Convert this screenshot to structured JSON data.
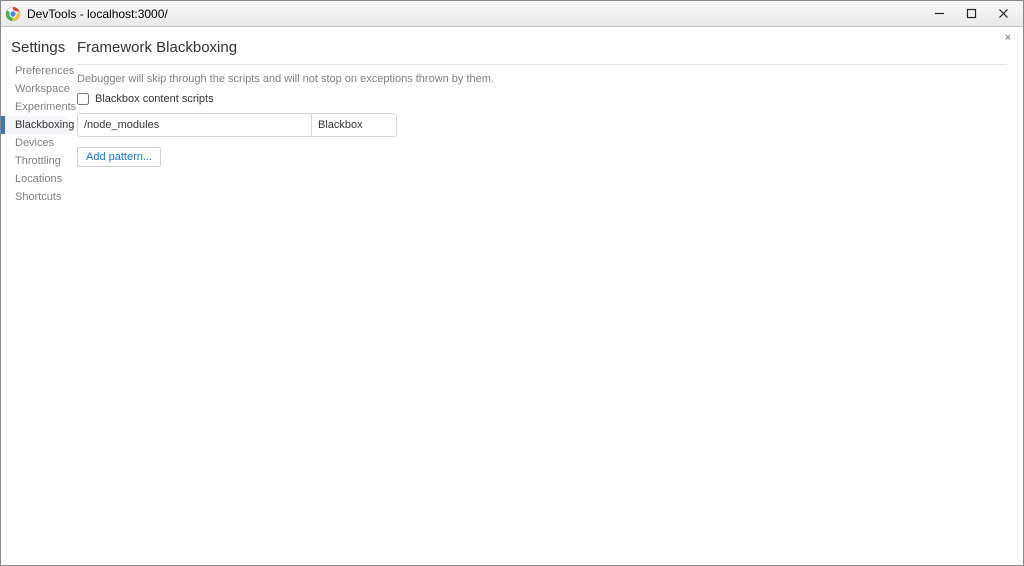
{
  "window": {
    "title": "DevTools - localhost:3000/"
  },
  "sidebar": {
    "title": "Settings",
    "items": [
      {
        "label": "Preferences"
      },
      {
        "label": "Workspace"
      },
      {
        "label": "Experiments"
      },
      {
        "label": "Blackboxing"
      },
      {
        "label": "Devices"
      },
      {
        "label": "Throttling"
      },
      {
        "label": "Locations"
      },
      {
        "label": "Shortcuts"
      }
    ],
    "active_index": 3
  },
  "main": {
    "title": "Framework Blackboxing",
    "description": "Debugger will skip through the scripts and will not stop on exceptions thrown by them.",
    "checkbox_label": "Blackbox content scripts",
    "checkbox_checked": false,
    "patterns": [
      {
        "pattern": "/node_modules",
        "behavior": "Blackbox"
      }
    ],
    "add_pattern_label": "Add pattern...",
    "close_label": "×"
  }
}
